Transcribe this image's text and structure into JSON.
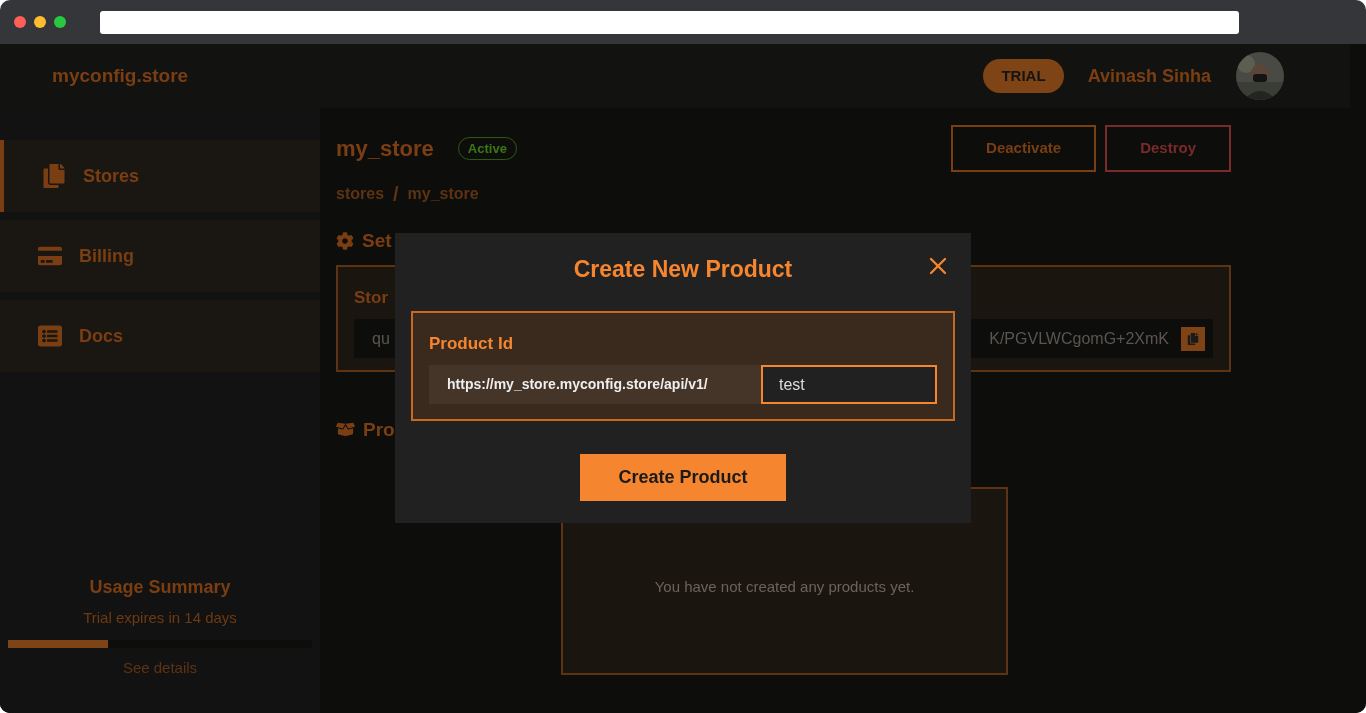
{
  "header": {
    "logo": "myconfig.store",
    "plan_badge": "TRIAL",
    "user_name": "Avinash Sinha"
  },
  "sidebar": {
    "items": [
      {
        "label": "Stores",
        "selected": true
      },
      {
        "label": "Billing",
        "selected": false
      },
      {
        "label": "Docs",
        "selected": false
      }
    ],
    "usage": {
      "title": "Usage Summary",
      "subtitle": "Trial expires in 14 days",
      "level": 0.33,
      "link": "See details"
    }
  },
  "page": {
    "title": "my_store",
    "status": "Active",
    "breadcrumbs": [
      "stores",
      "my_store"
    ],
    "breadcrumb_separator": "/",
    "buttons": [
      {
        "label": "Deactivate",
        "kind": "warning"
      },
      {
        "label": "Destroy",
        "kind": "danger"
      }
    ],
    "settings": {
      "heading": "Set",
      "card_label": "Stor",
      "key_start": "qu",
      "key_end": "K/PGVLWCgomG+2XmK"
    },
    "products": {
      "heading": "Pro",
      "empty_message": "You have not created any products yet."
    }
  },
  "modal": {
    "title": "Create New Product",
    "field_label": "Product Id",
    "url_prefix": "https://my_store.myconfig.store/api/v1/",
    "value": "test",
    "submit": "Create Product"
  }
}
